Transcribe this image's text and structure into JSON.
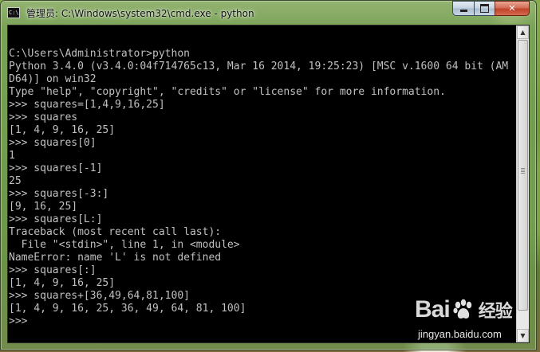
{
  "window": {
    "title": "管理员: C:\\Windows\\system32\\cmd.exe - python",
    "icon_text": "C:\\",
    "buttons": {
      "minimize": "minimize",
      "maximize": "maximize",
      "close": "✕"
    }
  },
  "console": {
    "lines": [
      "",
      "C:\\Users\\Administrator>python",
      "Python 3.4.0 (v3.4.0:04f714765c13, Mar 16 2014, 19:25:23) [MSC v.1600 64 bit (AM",
      "D64)] on win32",
      "Type \"help\", \"copyright\", \"credits\" or \"license\" for more information.",
      ">>> squares=[1,4,9,16,25]",
      ">>> squares",
      "[1, 4, 9, 16, 25]",
      ">>> squares[0]",
      "1",
      ">>> squares[-1]",
      "25",
      ">>> squares[-3:]",
      "[9, 16, 25]",
      ">>> squares[L:]",
      "Traceback (most recent call last):",
      "  File \"<stdin>\", line 1, in <module>",
      "NameError: name 'L' is not defined",
      ">>> squares[:]",
      "[1, 4, 9, 16, 25]",
      ">>> squares+[36,49,64,81,100]",
      "[1, 4, 9, 16, 25, 36, 49, 64, 81, 100]",
      ">>>"
    ]
  },
  "watermark": {
    "logo_left": "Bai",
    "logo_right": "经验",
    "url": "jingyan.baidu.com"
  },
  "colors": {
    "console_bg": "#000000",
    "console_text": "#c0c0c0",
    "close_button": "#c1432a"
  }
}
